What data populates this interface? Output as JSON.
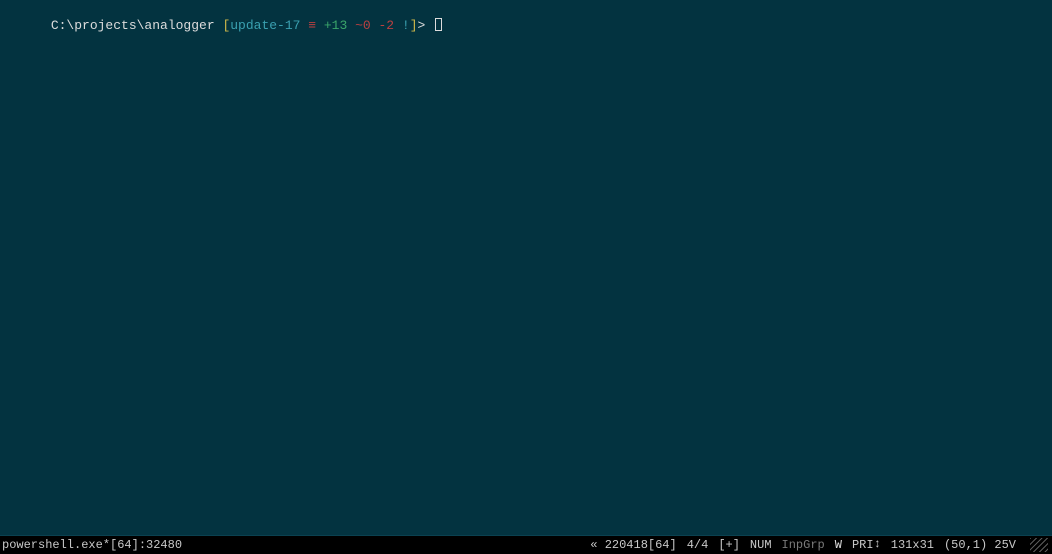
{
  "prompt": {
    "path": "C:\\projects\\analogger",
    "open_bracket": " [",
    "branch": "update-17",
    "equiv": " ≡",
    "plus": " +13",
    "tilde": " ~0",
    "minus": " -2",
    "bang": " !",
    "close_bracket": "]",
    "angle": ">"
  },
  "statusbar": {
    "process": "powershell.exe*[64]:32480",
    "guillemet": "«",
    "buffer": "220418[64]",
    "ratio": "4/4",
    "plus": "[+]",
    "num": "NUM",
    "inpgrp": "InpGrp",
    "w": "W",
    "pri": "PRI",
    "pri_arrow": "↕",
    "dims": "131x31",
    "pos": "(50,1) 25V"
  }
}
